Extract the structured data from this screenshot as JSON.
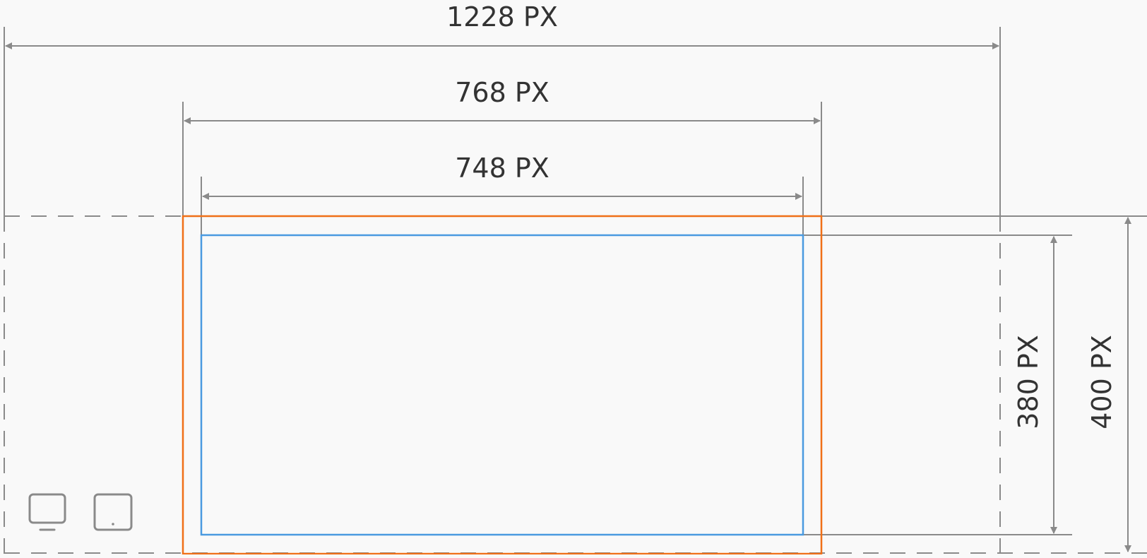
{
  "colors": {
    "background": "#f9f9f9",
    "dimension_line": "#8a8a8a",
    "label_text": "#333333",
    "container_outline": "#f07018",
    "content_outline": "#4a9ae0",
    "guide_dash": "#8a8a8a"
  },
  "dimensions": {
    "outer_width_label": "1228 PX",
    "container_width_label": "768 PX",
    "content_width_label": "748 PX",
    "content_height_label": "380 PX",
    "container_height_label": "400 PX"
  },
  "devices": [
    {
      "name": "desktop",
      "icon": "monitor-icon"
    },
    {
      "name": "tablet",
      "icon": "tablet-icon"
    }
  ]
}
